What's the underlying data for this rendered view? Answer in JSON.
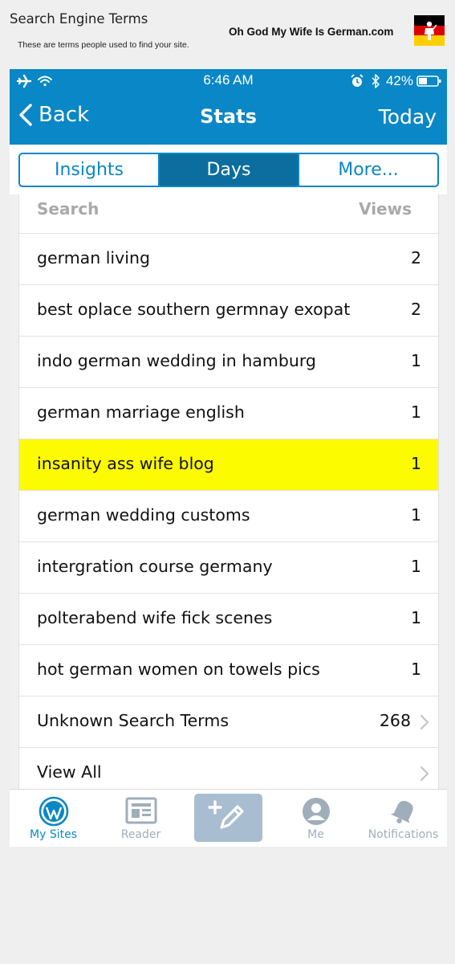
{
  "caption": {
    "title": "Search Engine Terms",
    "subtitle": "These are terms people used to find your site.",
    "site_name": "Oh God My Wife Is German.com"
  },
  "status_bar": {
    "time": "6:46 AM",
    "battery": "42%"
  },
  "navbar": {
    "back_label": "Back",
    "title": "Stats",
    "right_label": "Today"
  },
  "segments": [
    {
      "label": "Insights",
      "active": false
    },
    {
      "label": "Days",
      "active": true
    },
    {
      "label": "More...",
      "active": false
    }
  ],
  "table": {
    "header_search": "Search",
    "header_views": "Views",
    "rows": [
      {
        "term": "german living",
        "views": "2"
      },
      {
        "term": "best oplace southern germnay exopat",
        "views": "2"
      },
      {
        "term": "indo german wedding in hamburg",
        "views": "1"
      },
      {
        "term": "german marriage english",
        "views": "1"
      },
      {
        "term": "insanity ass wife blog",
        "views": "1",
        "highlighted": true
      },
      {
        "term": "german wedding customs",
        "views": "1"
      },
      {
        "term": "intergration course germany",
        "views": "1"
      },
      {
        "term": "polterabend wife fick scenes",
        "views": "1"
      },
      {
        "term": "hot german women on towels pics",
        "views": "1"
      }
    ],
    "unknown_label": "Unknown Search Terms",
    "unknown_count": "268",
    "view_all_label": "View All"
  },
  "tabbar": {
    "my_sites": "My Sites",
    "reader": "Reader",
    "me": "Me",
    "notifications": "Notifications"
  },
  "colors": {
    "header": "#0a87c6",
    "highlight": "#fdfb00",
    "tab_inactive": "#a0aebb"
  }
}
